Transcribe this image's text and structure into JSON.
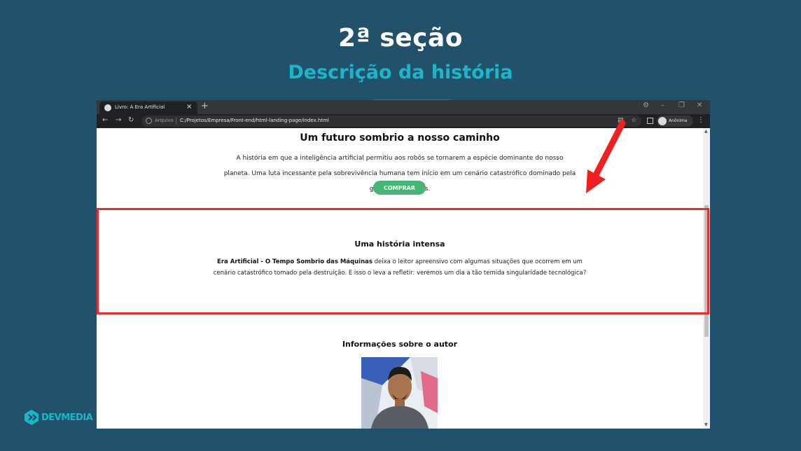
{
  "slide": {
    "title": "2ª seção",
    "subtitle": "Descrição da história"
  },
  "browser": {
    "tab_title": "Livro: A Era Artificial",
    "tab_close": "×",
    "new_tab": "+",
    "omnibox_label": "Arquivo",
    "url": "C:/Projetos/Empresa/Front-end/html-landing-page/index.html",
    "profile_name": "Anônima"
  },
  "page": {
    "section1": {
      "title": "Um futuro sombrio a nosso caminho",
      "text": "A história em que a inteligência artificial permitiu aos robôs se tornarem a espécie dominante do nosso planeta. Uma luta incessante pela sobrevivência humana tem início em um cenário catastrófico dominado pela guerra e pelo caos.",
      "button": "COMPRAR"
    },
    "section2": {
      "title": "Uma história intensa",
      "bold": "Era Artificial - O Tempo Sombrio das Máquinas",
      "text": " deixa o leitor apreensivo com algumas situações que ocorrem em um cenário catastrófico tomado pela destruição. E isso o leva a refletir: veremos um dia a tão temida singularidade tecnológica?"
    },
    "section3": {
      "title": "Informações sobre o autor"
    }
  },
  "logo": {
    "text": "DEVMEDIA"
  },
  "colors": {
    "background": "#22526b",
    "accent": "#1ab6c9",
    "button": "#44b774",
    "highlight": "#ee2a2a"
  }
}
